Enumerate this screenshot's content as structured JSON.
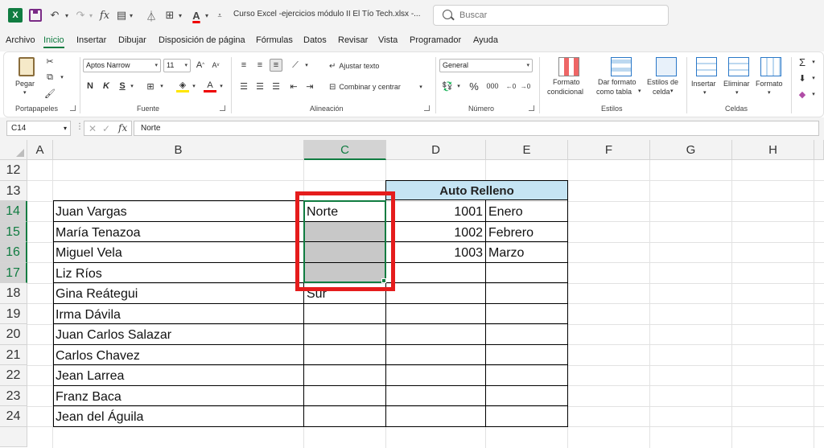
{
  "titlebar": {
    "file_title": "Curso Excel -ejercicios módulo II El Tío Tech.xlsx  -...",
    "search_placeholder": "Buscar",
    "icons": [
      "excel-logo-icon",
      "save-icon",
      "undo-icon",
      "redo-icon",
      "fx-icon",
      "form-icon",
      "filter-icon",
      "borders-icon",
      "font-color-icon",
      "customize-qat-icon"
    ]
  },
  "menu": {
    "tabs": [
      "Archivo",
      "Inicio",
      "Insertar",
      "Dibujar",
      "Disposición de página",
      "Fórmulas",
      "Datos",
      "Revisar",
      "Vista",
      "Programador",
      "Ayuda"
    ],
    "active": "Inicio"
  },
  "ribbon": {
    "portapapeles": {
      "label": "Portapapeles",
      "paste": "Pegar"
    },
    "fuente": {
      "label": "Fuente",
      "font_name": "Aptos Narrow",
      "font_size": "11",
      "bold": "N",
      "italic": "K",
      "underline": "S"
    },
    "alineacion": {
      "label": "Alineación",
      "wrap_text": "Ajustar texto",
      "merge_center": "Combinar y centrar"
    },
    "numero": {
      "label": "Número",
      "format": "General",
      "percent": "%",
      "thousands": "000"
    },
    "estilos": {
      "label": "Estilos",
      "cond_format_1": "Formato",
      "cond_format_2": "condicional",
      "table_format_1": "Dar formato",
      "table_format_2": "como tabla",
      "cell_styles_1": "Estilos de",
      "cell_styles_2": "celda"
    },
    "celdas": {
      "label": "Celdas",
      "insert": "Insertar",
      "delete": "Eliminar",
      "format": "Formato"
    }
  },
  "formula_bar": {
    "name_box": "C14",
    "formula": "Norte"
  },
  "grid": {
    "columns": [
      "A",
      "B",
      "C",
      "D",
      "E",
      "F",
      "G",
      "H"
    ],
    "selected_column": "C",
    "rows": [
      "12",
      "13",
      "14",
      "15",
      "16",
      "17",
      "18",
      "19",
      "20",
      "21",
      "22",
      "23",
      "24"
    ],
    "selected_rows": [
      "14",
      "15",
      "16",
      "17"
    ],
    "auto_relleno_header": "Auto Relleno",
    "names": [
      "Juan Vargas",
      "María Tenazoa",
      "Miguel Vela",
      "Liz Ríos",
      "Gina Reátegui",
      "Irma Dávila",
      "Juan Carlos Salazar",
      "Carlos Chavez",
      "Jean Larrea",
      "Franz Baca",
      "Jean del Águila"
    ],
    "col_c": [
      "Norte",
      "",
      "",
      "",
      "Sur",
      "",
      "",
      "",
      "",
      "",
      ""
    ],
    "col_d": [
      "1001",
      "1002",
      "1003"
    ],
    "col_e": [
      "Enero",
      "Febrero",
      "Marzo"
    ],
    "colors": {
      "header_fill": "#c5e4f3",
      "fill_range": "#c8c8c8",
      "selection": "#107c41",
      "highlight": "#e51c1c"
    }
  }
}
